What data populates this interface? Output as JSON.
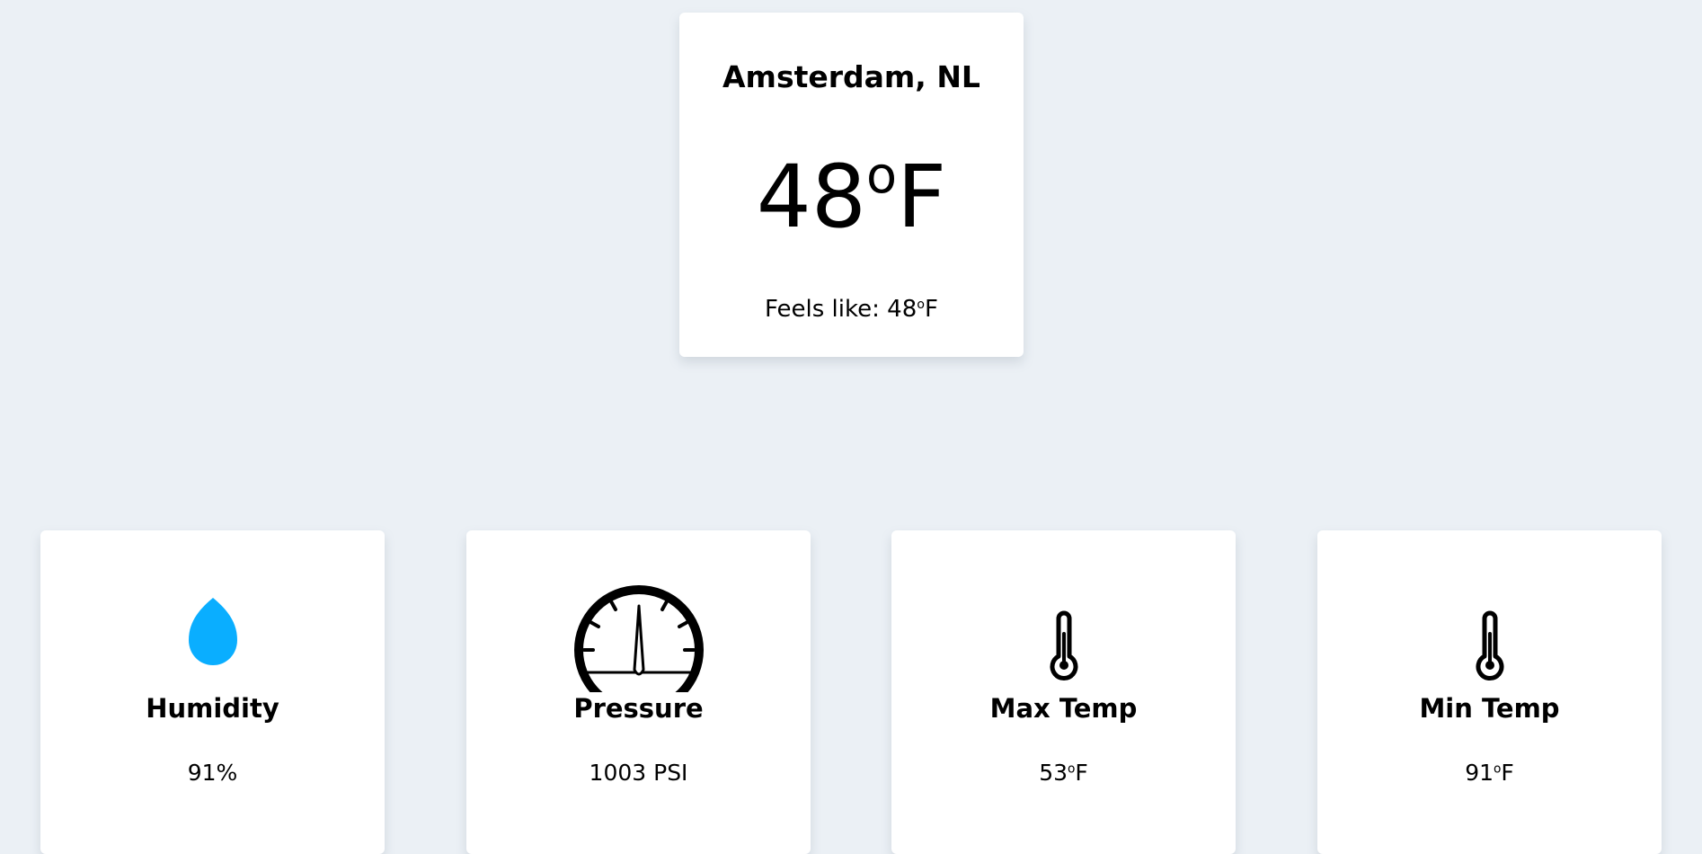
{
  "current": {
    "location": "Amsterdam, NL",
    "temperature": "48",
    "feels_like_label": "Feels like: ",
    "feels_like_value": "48",
    "degree_symbol": "o",
    "unit": "F"
  },
  "stats": [
    {
      "label": "Humidity",
      "value": "91%",
      "icon": "water-drop-icon",
      "icon_color": "#0aaeff"
    },
    {
      "label": "Pressure",
      "value": "1003 PSI",
      "icon": "gauge-icon",
      "icon_color": "#000000"
    },
    {
      "label": "Max Temp",
      "value": "53",
      "degree_symbol": "o",
      "unit": "F",
      "icon": "thermometer-icon",
      "icon_color": "#000000"
    },
    {
      "label": "Min Temp",
      "value": "91",
      "degree_symbol": "o",
      "unit": "F",
      "icon": "thermometer-icon",
      "icon_color": "#000000"
    }
  ],
  "colors": {
    "background": "#ebf0f5",
    "card": "#ffffff",
    "humidity_drop": "#0aaeff",
    "text": "#000000"
  }
}
